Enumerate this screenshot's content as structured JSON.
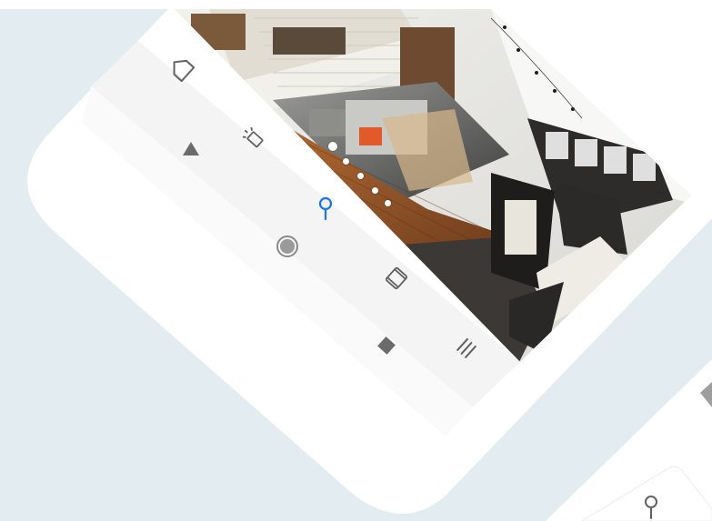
{
  "app": {
    "carousel": {
      "active_index": 0,
      "count": 5
    },
    "nav": {
      "icons": [
        "home-icon",
        "flash-icon",
        "play-icon",
        "location-pin-icon",
        "record-icon",
        "rotate-icon",
        "stop-icon",
        "menu-icon"
      ]
    },
    "colors": {
      "background": "#e3ecf0",
      "phone": "#ffffff",
      "nav_band": "#f5f5f5",
      "icon": "#616161",
      "accent": "#1a73e8"
    }
  }
}
